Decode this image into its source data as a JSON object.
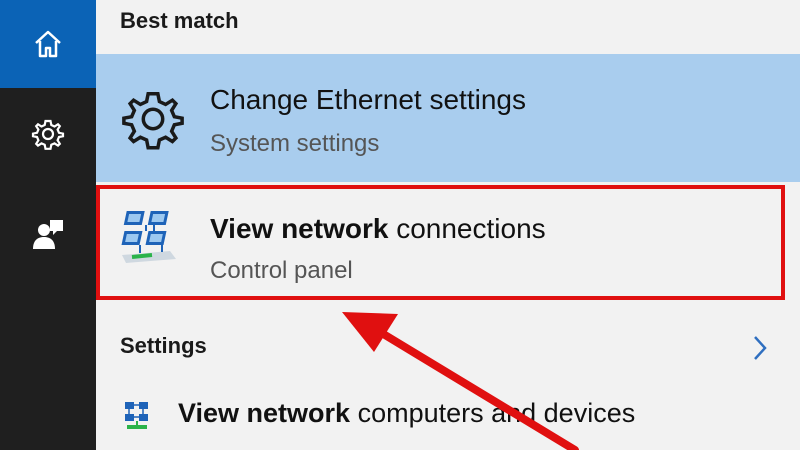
{
  "rail": {
    "items": [
      {
        "name": "home",
        "icon": "home-icon"
      },
      {
        "name": "settings",
        "icon": "gear-icon"
      },
      {
        "name": "feedback",
        "icon": "person-feedback-icon"
      }
    ],
    "accent_color": "#0b63b6"
  },
  "sections": {
    "best_match": "Best match",
    "settings": "Settings"
  },
  "results": {
    "ethernet": {
      "title": "Change Ethernet settings",
      "subtitle": "System settings",
      "icon": "gear-icon",
      "selected": true
    },
    "network_connections": {
      "title_bold": "View network",
      "title_rest": " connections",
      "subtitle": "Control panel",
      "icon": "network-connections-icon",
      "highlighted": true
    },
    "network_devices": {
      "title_bold": "View network",
      "title_rest": " computers and devices",
      "icon": "network-computers-icon"
    }
  },
  "annotation": {
    "type": "red-arrow",
    "color": "#e01010"
  }
}
